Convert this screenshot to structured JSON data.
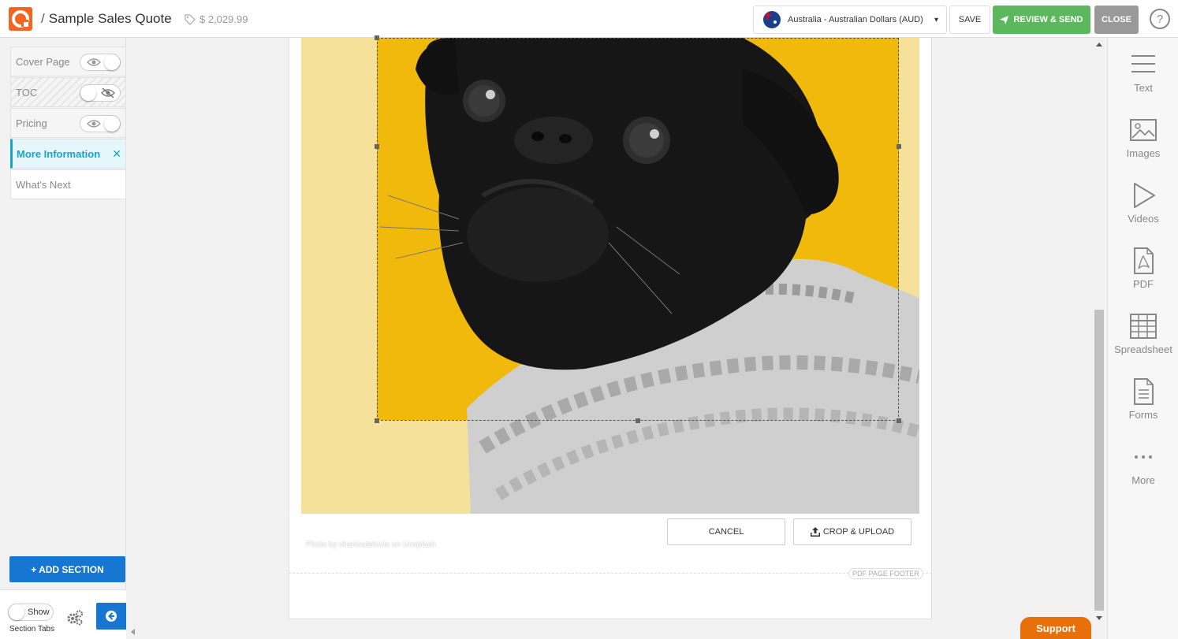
{
  "header": {
    "title_separator": "/",
    "title": "Sample Sales Quote",
    "price": "$ 2,029.99",
    "currency_label": "Australia - Australian Dollars (AUD)",
    "save_label": "SAVE",
    "review_label": "REVIEW & SEND",
    "close_label": "CLOSE",
    "help_label": "?"
  },
  "sidebar": {
    "sections": [
      {
        "label": "Cover Page",
        "visible": true
      },
      {
        "label": "TOC",
        "visible": false
      },
      {
        "label": "Pricing",
        "visible": true
      },
      {
        "label": "More Information",
        "active": true
      },
      {
        "label": "What's Next"
      }
    ],
    "remove_label": "✕",
    "add_section_label": "+ ADD SECTION",
    "show_toggle_label": "Show",
    "section_tabs_label": "Section Tabs"
  },
  "editor": {
    "photo_credit": "Photo by charlesdeluvio on Unsplash",
    "cancel_label": "CANCEL",
    "crop_upload_label": "CROP & UPLOAD",
    "pdf_footer_label": "PDF PAGE FOOTER"
  },
  "tools": [
    {
      "label": "Text",
      "icon": "text-icon"
    },
    {
      "label": "Images",
      "icon": "image-icon"
    },
    {
      "label": "Videos",
      "icon": "play-icon"
    },
    {
      "label": "PDF",
      "icon": "pdf-icon"
    },
    {
      "label": "Spreadsheet",
      "icon": "grid-icon"
    },
    {
      "label": "Forms",
      "icon": "form-icon"
    },
    {
      "label": "More",
      "icon": "more-icon"
    }
  ],
  "support_label": "Support",
  "colors": {
    "brand_orange": "#f26522",
    "review_green": "#5cb85c",
    "active_teal": "#1aa3c8",
    "primary_blue": "#1776d2",
    "photo_yellow": "#f0b90c"
  }
}
